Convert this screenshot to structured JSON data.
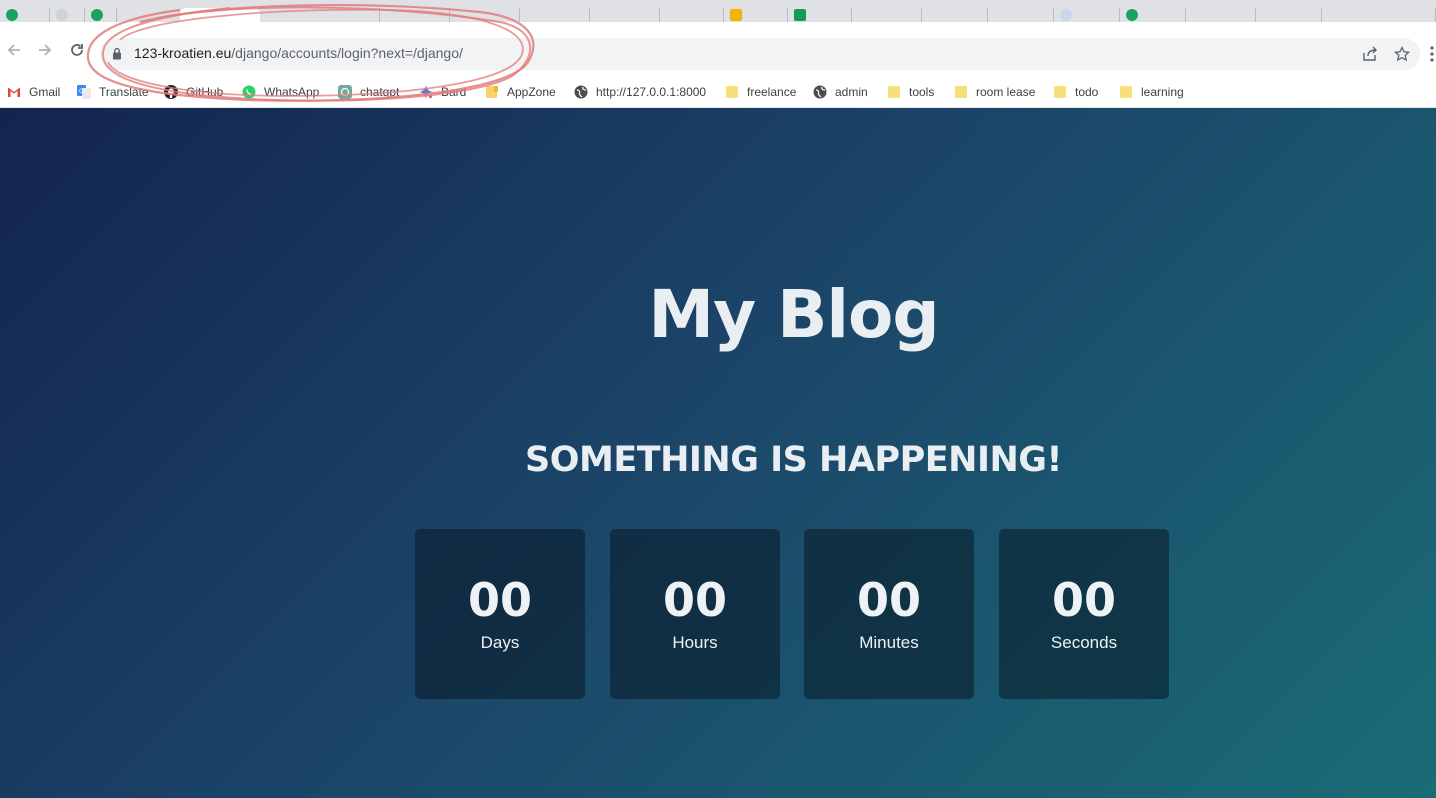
{
  "browser": {
    "address_bar": {
      "host": "123-kroatien.eu",
      "path": "/django/accounts/login?next=/django/"
    },
    "bookmarks": [
      {
        "label": "Gmail",
        "icon": "gmail-icon"
      },
      {
        "label": "Translate",
        "icon": "translate-icon"
      },
      {
        "label": "GitHub",
        "icon": "github-icon"
      },
      {
        "label": "WhatsApp",
        "icon": "whatsapp-icon"
      },
      {
        "label": "chatgpt",
        "icon": "chatgpt-icon"
      },
      {
        "label": "Bard",
        "icon": "bard-icon"
      },
      {
        "label": "AppZone",
        "icon": "folder-icon"
      },
      {
        "label": "http://127.0.0.1:8000",
        "icon": "globe-icon"
      },
      {
        "label": "freelance",
        "icon": "folder-icon"
      },
      {
        "label": "admin",
        "icon": "globe-icon"
      },
      {
        "label": "tools",
        "icon": "folder-icon"
      },
      {
        "label": "room lease",
        "icon": "folder-icon"
      },
      {
        "label": "todo",
        "icon": "folder-icon"
      },
      {
        "label": "learning",
        "icon": "folder-icon"
      }
    ],
    "annotation_color": "#e05a5a"
  },
  "page": {
    "title": "My Blog",
    "subtitle": "SOMETHING IS HAPPENING!",
    "countdown": [
      {
        "value": "00",
        "label": "Days"
      },
      {
        "value": "00",
        "label": "Hours"
      },
      {
        "value": "00",
        "label": "Minutes"
      },
      {
        "value": "00",
        "label": "Seconds"
      }
    ],
    "colors": {
      "gradient_start": "#13244f",
      "gradient_end": "#1a6c76",
      "text": "#e9eef2"
    }
  }
}
